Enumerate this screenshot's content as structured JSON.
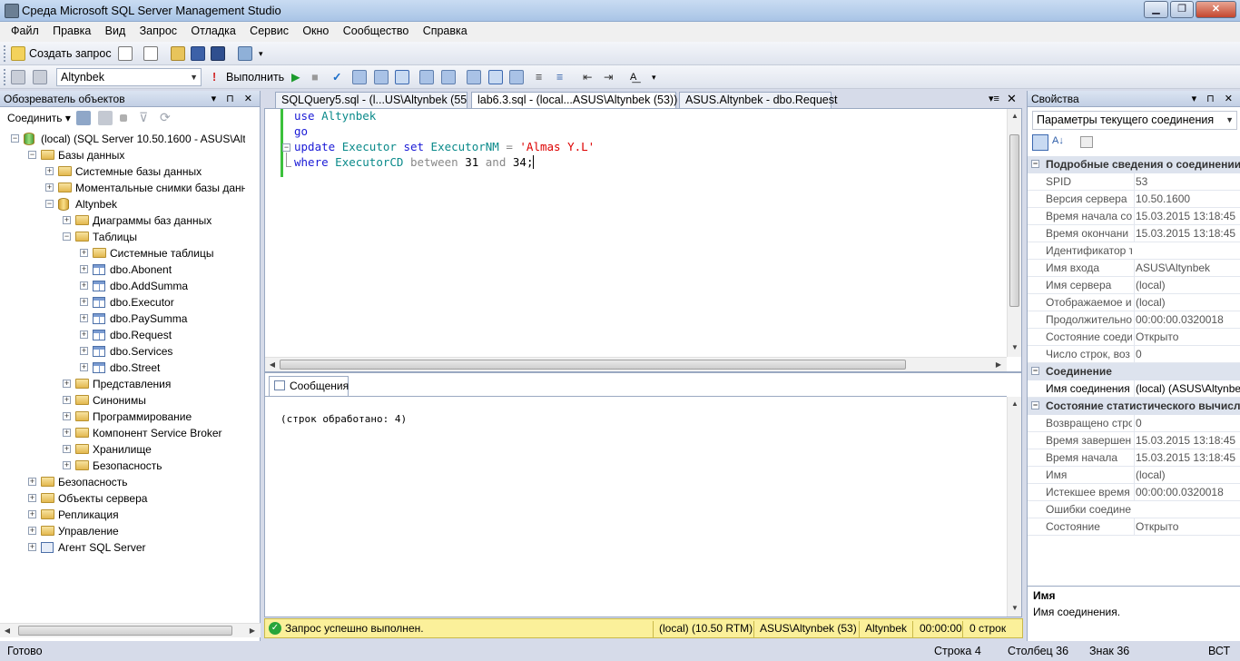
{
  "window": {
    "title": "Среда Microsoft SQL Server Management Studio"
  },
  "menu": [
    "Файл",
    "Правка",
    "Вид",
    "Запрос",
    "Отладка",
    "Сервис",
    "Окно",
    "Сообщество",
    "Справка"
  ],
  "toolbar1": {
    "new_query": "Создать запрос"
  },
  "toolbar2": {
    "database": "Altynbek",
    "execute": "Выполнить"
  },
  "object_explorer": {
    "title": "Обозреватель объектов",
    "connect": "Соединить",
    "tree": [
      {
        "label": "(local) (SQL Server 10.50.1600 - ASUS\\Altynbek",
        "level": 0,
        "icon": "server",
        "expanded": true
      },
      {
        "label": "Базы данных",
        "level": 1,
        "icon": "folder",
        "expanded": true
      },
      {
        "label": "Системные базы данных",
        "level": 2,
        "icon": "folder",
        "expanded": false
      },
      {
        "label": "Моментальные снимки базы данных",
        "level": 2,
        "icon": "folder",
        "expanded": false
      },
      {
        "label": "Altynbek",
        "level": 2,
        "icon": "database",
        "expanded": true
      },
      {
        "label": "Диаграммы баз данных",
        "level": 3,
        "icon": "folder",
        "expanded": false
      },
      {
        "label": "Таблицы",
        "level": 3,
        "icon": "folder",
        "expanded": true
      },
      {
        "label": "Системные таблицы",
        "level": 4,
        "icon": "folder",
        "expanded": false
      },
      {
        "label": "dbo.Abonent",
        "level": 4,
        "icon": "table",
        "expanded": false
      },
      {
        "label": "dbo.AddSumma",
        "level": 4,
        "icon": "table",
        "expanded": false
      },
      {
        "label": "dbo.Executor",
        "level": 4,
        "icon": "table",
        "expanded": false
      },
      {
        "label": "dbo.PaySumma",
        "level": 4,
        "icon": "table",
        "expanded": false
      },
      {
        "label": "dbo.Request",
        "level": 4,
        "icon": "table",
        "expanded": false
      },
      {
        "label": "dbo.Services",
        "level": 4,
        "icon": "table",
        "expanded": false
      },
      {
        "label": "dbo.Street",
        "level": 4,
        "icon": "table",
        "expanded": false
      },
      {
        "label": "Представления",
        "level": 3,
        "icon": "folder",
        "expanded": false
      },
      {
        "label": "Синонимы",
        "level": 3,
        "icon": "folder",
        "expanded": false
      },
      {
        "label": "Программирование",
        "level": 3,
        "icon": "folder",
        "expanded": false
      },
      {
        "label": "Компонент Service Broker",
        "level": 3,
        "icon": "folder",
        "expanded": false
      },
      {
        "label": "Хранилище",
        "level": 3,
        "icon": "folder",
        "expanded": false
      },
      {
        "label": "Безопасность",
        "level": 3,
        "icon": "folder",
        "expanded": false
      },
      {
        "label": "Безопасность",
        "level": 1,
        "icon": "folder",
        "expanded": false
      },
      {
        "label": "Объекты сервера",
        "level": 1,
        "icon": "folder",
        "expanded": false
      },
      {
        "label": "Репликация",
        "level": 1,
        "icon": "folder",
        "expanded": false
      },
      {
        "label": "Управление",
        "level": 1,
        "icon": "folder",
        "expanded": false
      },
      {
        "label": "Агент SQL Server",
        "level": 1,
        "icon": "agent",
        "expanded": false
      }
    ]
  },
  "editor_tabs": [
    "SQLQuery5.sql - (l...US\\Altynbek (55))*",
    "lab6.3.sql - (local...ASUS\\Altynbek (53))",
    "ASUS.Altynbek - dbo.Request"
  ],
  "code": {
    "line1": {
      "kw": "use",
      "id": "Altynbek"
    },
    "line2": {
      "kw": "go"
    },
    "line3": {
      "kw1": "update",
      "id1": "Executor",
      "kw2": "set",
      "id2": "ExecutorNM",
      "op": "=",
      "str": "'Almas Y.L'"
    },
    "line4": {
      "kw1": "where",
      "id1": "ExecutorCD",
      "kw2": "between",
      "n1": "31",
      "kw3": "and",
      "n2": "34;"
    }
  },
  "results": {
    "tab": "Сообщения",
    "message": "(строк обработано: 4)"
  },
  "query_status": {
    "message": "Запрос успешно выполнен.",
    "server": "(local) (10.50 RTM)",
    "user": "ASUS\\Altynbek (53)",
    "db": "Altynbek",
    "time": "00:00:00",
    "rows": "0 строк"
  },
  "properties": {
    "title": "Свойства",
    "selector": "Параметры текущего соединения",
    "categories": [
      {
        "name": "Подробные сведения о соединении",
        "rows": [
          [
            "SPID",
            "53"
          ],
          [
            "Версия сервера",
            "10.50.1600"
          ],
          [
            "Время начала со",
            "15.03.2015 13:18:45"
          ],
          [
            "Время окончани",
            "15.03.2015 13:18:45"
          ],
          [
            "Идентификатор т",
            ""
          ],
          [
            "Имя входа",
            "ASUS\\Altynbek"
          ],
          [
            "Имя сервера",
            "(local)"
          ],
          [
            "Отображаемое и",
            "(local)"
          ],
          [
            "Продолжительно",
            "00:00:00.0320018"
          ],
          [
            "Состояние соеди",
            "Открыто"
          ],
          [
            "Число строк, воз",
            "0"
          ]
        ]
      },
      {
        "name": "Соединение",
        "rows": [
          [
            "Имя соединения",
            "(local) (ASUS\\Altynbek"
          ]
        ]
      },
      {
        "name": "Состояние статистического вычисле",
        "rows": [
          [
            "Возвращено стро",
            "0"
          ],
          [
            "Время завершен",
            "15.03.2015 13:18:45"
          ],
          [
            "Время начала",
            "15.03.2015 13:18:45"
          ],
          [
            "Имя",
            "(local)"
          ],
          [
            "Истекшее время",
            "00:00:00.0320018"
          ],
          [
            "Ошибки соедине",
            ""
          ],
          [
            "Состояние",
            "Открыто"
          ]
        ]
      }
    ],
    "desc_title": "Имя",
    "desc_text": "Имя соединения."
  },
  "statusbar": {
    "ready": "Готово",
    "line": "Строка 4",
    "col": "Столбец 36",
    "ch": "Знак 36",
    "mode": "ВСТ"
  },
  "colors": {
    "accent": "#2e5fa8",
    "status_yellow": "#fbf09a",
    "keyword": "#1a1ad6",
    "string": "#dd0000"
  }
}
